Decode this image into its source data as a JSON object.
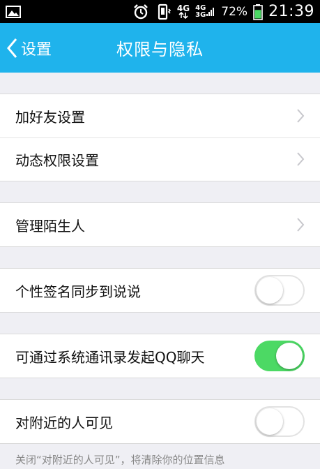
{
  "status_bar": {
    "image_icon": "image-icon",
    "alarm_icon": "alarm-icon",
    "vibrate_icon": "vibrate-icon",
    "net_4g": "4G",
    "net_4g_small": "4G",
    "net_3g_small": "3G",
    "battery_percent": "72%",
    "battery_level": 0.72,
    "time": "21:39"
  },
  "nav": {
    "back_label": "设置",
    "title": "权限与隐私",
    "bar_color": "#1fb3ec"
  },
  "groups": [
    {
      "rows": [
        {
          "label": "加好友设置",
          "control": "chevron"
        },
        {
          "label": "动态权限设置",
          "control": "chevron"
        }
      ]
    },
    {
      "rows": [
        {
          "label": "管理陌生人",
          "control": "chevron"
        }
      ]
    },
    {
      "rows": [
        {
          "label": "个性签名同步到说说",
          "control": "toggle",
          "on": false
        }
      ]
    },
    {
      "rows": [
        {
          "label": "可通过系统通讯录发起QQ聊天",
          "control": "toggle",
          "on": true
        }
      ]
    },
    {
      "rows": [
        {
          "label": "对附近的人可见",
          "control": "toggle",
          "on": false
        }
      ]
    }
  ],
  "footnote": "关闭“对附近的人可见”，将清除你的位置信息",
  "colors": {
    "toggle_on": "#4cd964",
    "background": "#efeff4"
  }
}
